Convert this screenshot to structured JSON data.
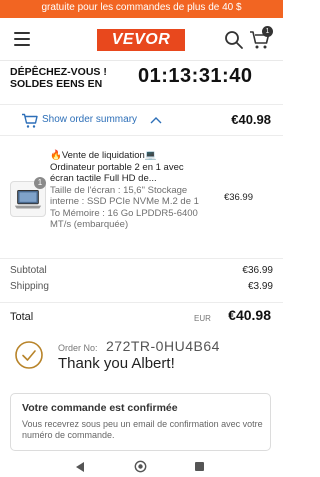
{
  "promo": {
    "text": "gratuite pour les commandes de plus de 40 $"
  },
  "header": {
    "logo": "VEVOR",
    "cart_count": "1",
    "icons": {
      "menu": "hamburger-menu-icon",
      "search": "search-icon",
      "cart": "cart-icon"
    }
  },
  "countdown": {
    "label": "DÉPÊCHEZ-VOUS ! SOLDES EENS EN",
    "time": "01:13:31:40"
  },
  "summary": {
    "toggle_label": "Show order summary",
    "total": "€40.98"
  },
  "product": {
    "quantity": "1",
    "title": "🔥Vente de liquidation💻 Ordinateur portable 2 en 1 avec écran tactile Full HD de...",
    "variant": "Taille de l'écran : 15,6\" Stockage interne : SSD PCIe NVMe M.2 de 1 To Mémoire : 16 Go LPDDR5-6400 MT/s (embarquée)",
    "price": "€36.99"
  },
  "totals": {
    "subtotal_label": "Subtotal",
    "subtotal": "€36.99",
    "shipping_label": "Shipping",
    "shipping": "€3.99",
    "total_label": "Total",
    "currency": "EUR",
    "total": "€40.98"
  },
  "order": {
    "number_label": "Order No:",
    "number": "272TR-0HU4B64",
    "thanks": "Thank you Albert!"
  },
  "confirmation": {
    "title": "Votre commande est confirmée",
    "message": "Vous recevrez sous peu un email de confirmation avec votre numéro de commande."
  },
  "colors": {
    "brand": "#e8481d",
    "promo": "#f26522",
    "link": "#2d6fb8",
    "check": "#b8842a"
  }
}
